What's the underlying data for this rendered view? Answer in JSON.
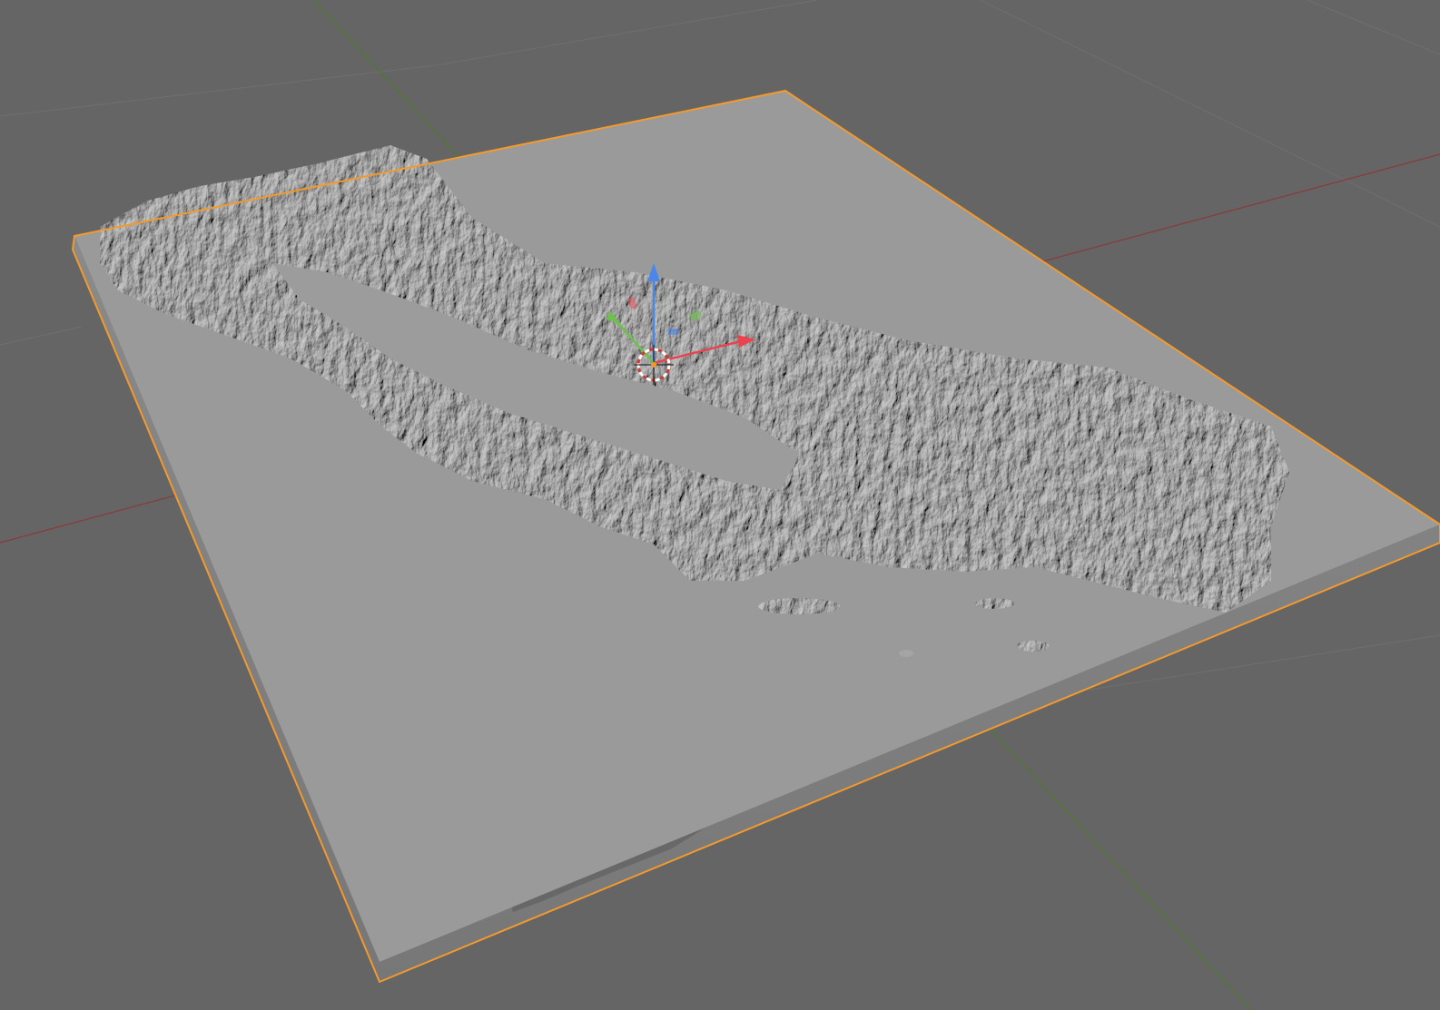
{
  "viewport": {
    "background": "#656565",
    "grid_color": "#6f6f6f",
    "x_axis_color": "#8a3a3a",
    "y_axis_color": "#4f7a2a",
    "selection_outline_color": "#f29a2e"
  },
  "scene": {
    "object": "terrain-relief-plate",
    "object_selected": true,
    "plate_top_color": "#9a9a9a",
    "plate_side_color": "#7e7e7e",
    "terrain_color": "#a6a6a6"
  },
  "gizmo": {
    "icons": [
      "z-axis-arrow-icon",
      "x-axis-arrow-icon",
      "y-axis-arrow-icon",
      "3d-cursor-icon"
    ],
    "x_color": "#e8434f",
    "y_color": "#6cc24a",
    "z_color": "#4c87e8"
  }
}
